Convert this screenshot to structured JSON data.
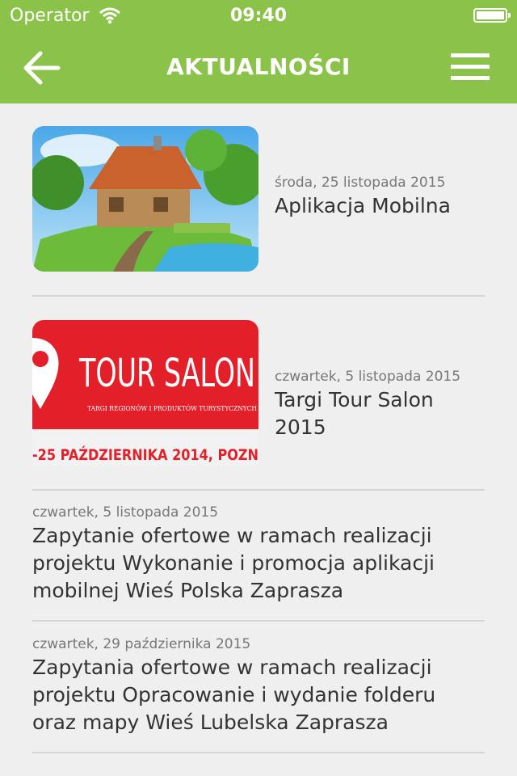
{
  "status_bar": {
    "carrier": "Operator",
    "time": "09:40"
  },
  "header": {
    "title": "AKTUALNOŚCI"
  },
  "colors": {
    "accent": "#8bc34a"
  },
  "news": [
    {
      "date": "środa, 25 listopada 2015",
      "title": "Aplikacja Mobilna",
      "image": "cottage-illustration"
    },
    {
      "date": "czwartek, 5 listopada 2015",
      "title": "Targi Tour Salon 2015",
      "image": "tour-salon-banner",
      "banner": {
        "brand": "TOUR SALON",
        "tagline": "TARGI REGIONÓW I PRODUKTÓW TURYSTYCZNYCH",
        "dates": "-25 PAŹDZIERNIKA 2014, POZN"
      }
    },
    {
      "date": "czwartek, 5 listopada 2015",
      "title": "Zapytanie ofertowe w ramach realizacji projektu Wykonanie i promocja aplikacji mobilnej Wieś Polska Zaprasza"
    },
    {
      "date": "czwartek, 29 października 2015",
      "title": "Zapytania ofertowe w ramach realizacji projektu Opracowanie i wydanie folderu oraz mapy Wieś Lubelska Zaprasza"
    }
  ]
}
